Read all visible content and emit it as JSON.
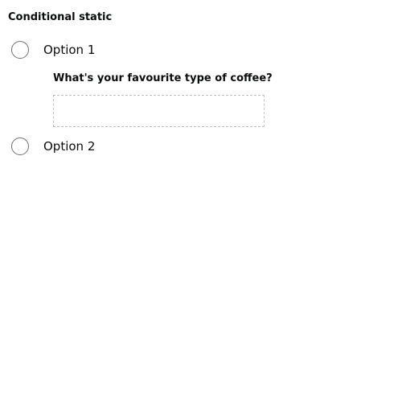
{
  "form": {
    "group_title": "Conditional static",
    "options": [
      {
        "label": "Option 1",
        "selected": false
      },
      {
        "label": "Option 2",
        "selected": false
      }
    ],
    "conditional": {
      "label": "What's your favourite type of coffee?",
      "value": ""
    }
  }
}
